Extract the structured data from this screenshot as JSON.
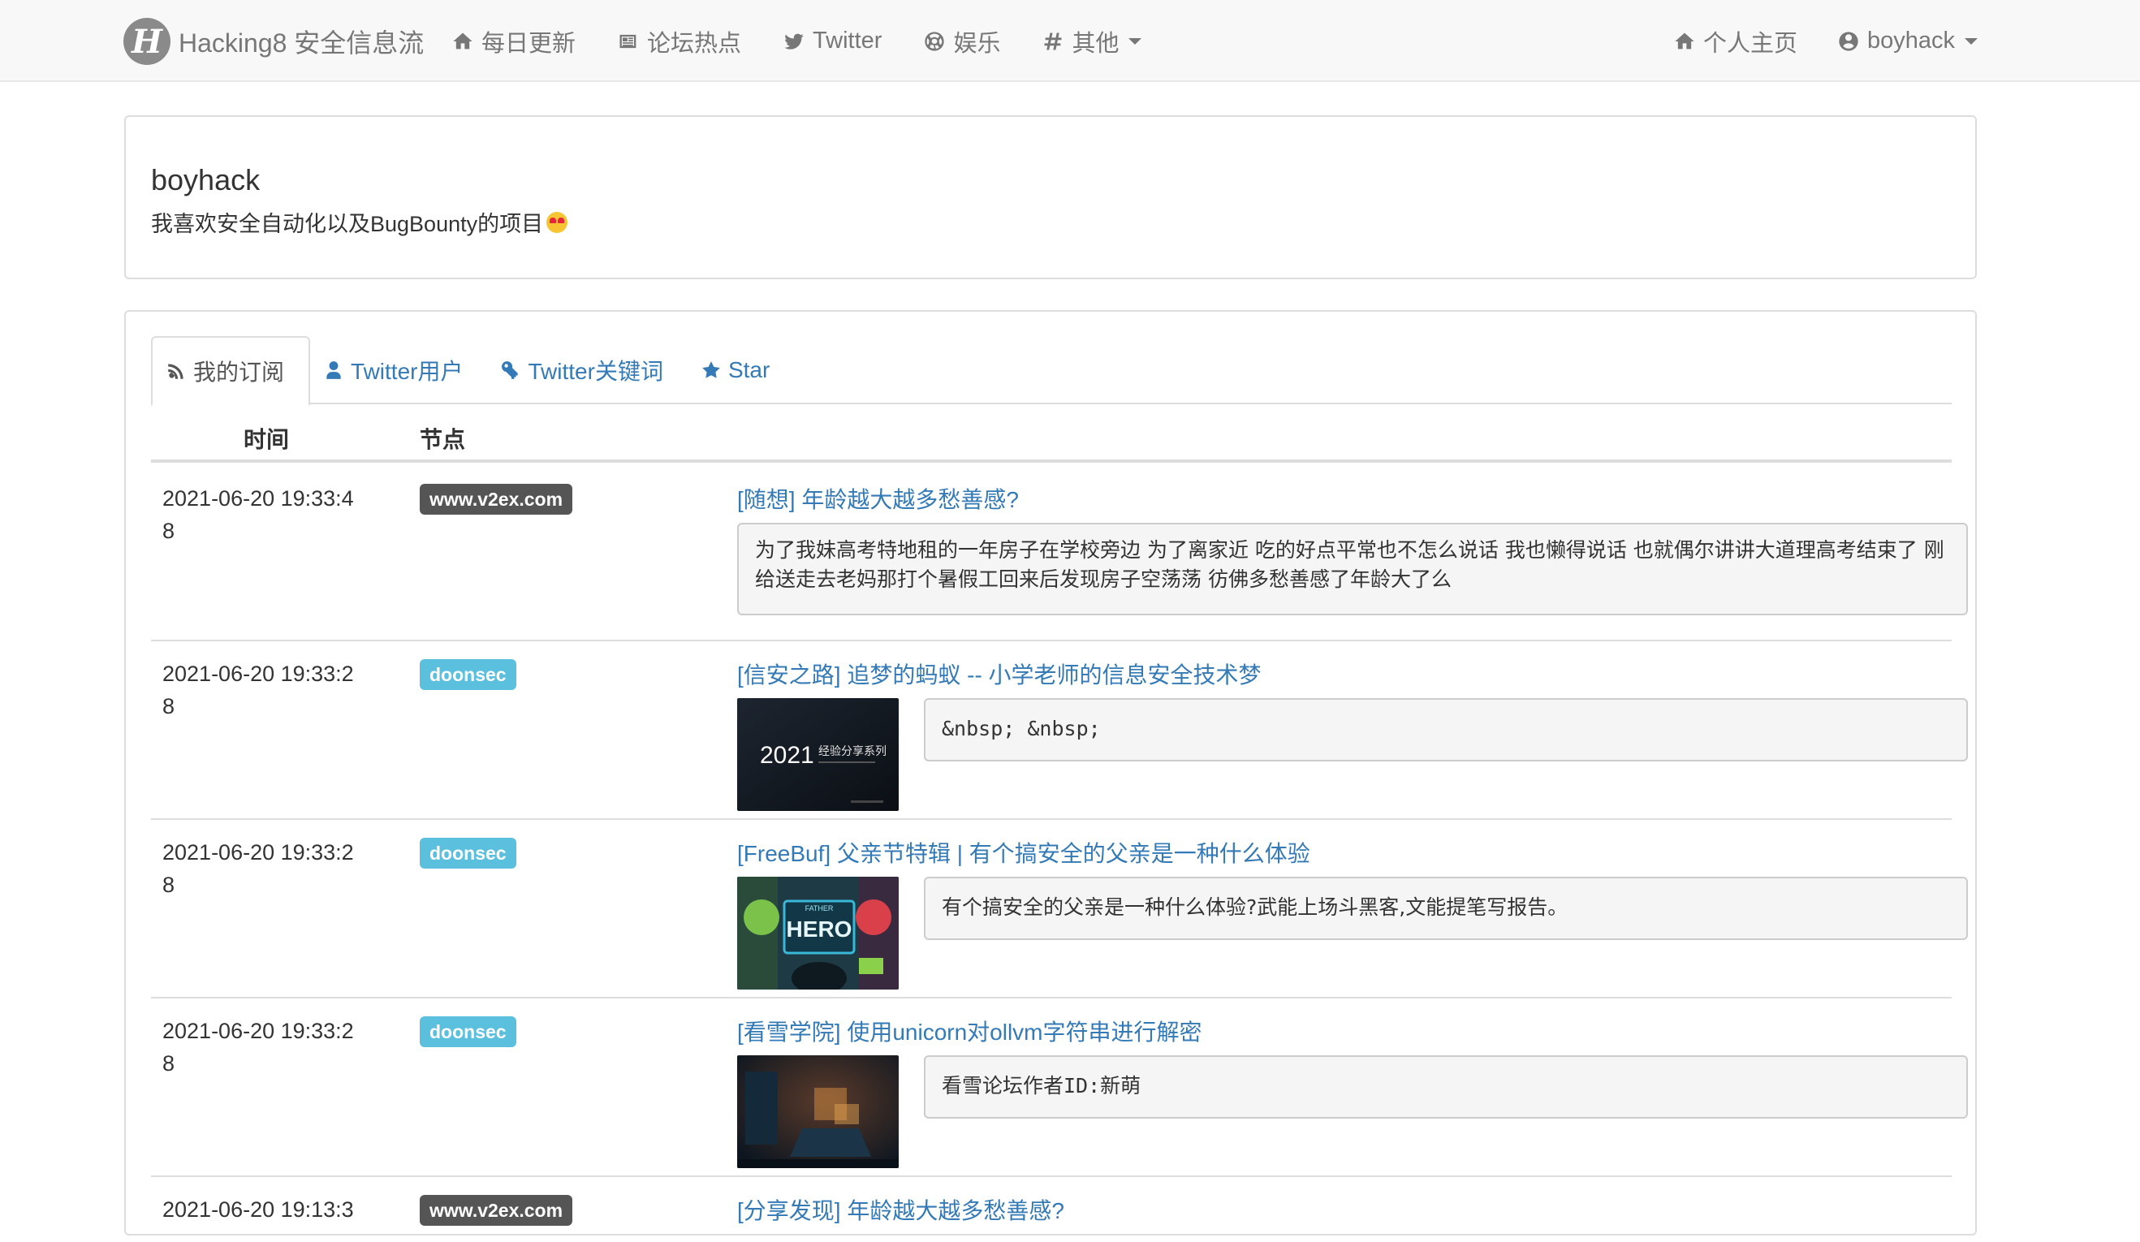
{
  "navbar": {
    "brand": "Hacking8 安全信息流",
    "brand_logo_letter": "H",
    "left_items": [
      {
        "label": "每日更新",
        "icon": "home-icon"
      },
      {
        "label": "论坛热点",
        "icon": "newspaper-icon"
      },
      {
        "label": "Twitter",
        "icon": "twitter-icon"
      },
      {
        "label": "娱乐",
        "icon": "soccer-ball-icon"
      },
      {
        "label": "其他",
        "icon": "hashtag-icon",
        "dropdown": true
      }
    ],
    "right_items": [
      {
        "label": "个人主页",
        "icon": "home-icon"
      },
      {
        "label": "boyhack",
        "icon": "user-circle-icon",
        "dropdown": true
      }
    ]
  },
  "profile": {
    "name": "boyhack",
    "bio": "我喜欢安全自动化以及BugBounty的项目"
  },
  "tabs": [
    {
      "label": "我的订阅",
      "icon": "rss-icon",
      "active": true
    },
    {
      "label": "Twitter用户",
      "icon": "user-icon",
      "active": false
    },
    {
      "label": "Twitter关键词",
      "icon": "key-icon",
      "active": false
    },
    {
      "label": "Star",
      "icon": "star-icon",
      "active": false
    }
  ],
  "table": {
    "headers": {
      "time": "时间",
      "node": "节点"
    },
    "rows": [
      {
        "time": "2021-06-20 19:33:48",
        "node": "www.v2ex.com",
        "node_color": "#555555",
        "title": "[随想] 年龄越大越多愁善感?",
        "desc": "为了我妹高考特地租的一年房子在学校旁边 为了离家近 吃的好点平常也不怎么说话 我也懒得说话 也就偶尔讲讲大道理高考结束了 刚给送走去老妈那打个暑假工回来后发现房子空荡荡 彷佛多愁善感了年龄大了么",
        "thumb": null
      },
      {
        "time": "2021-06-20 19:33:28",
        "node": "doonsec",
        "node_color": "#5bc0de",
        "title": "[信安之路] 追梦的蚂蚁 -- 小学老师的信息安全技术梦",
        "desc": "&nbsp; &nbsp;",
        "thumb": {
          "kind": "dark-banner",
          "text_big": "2021",
          "text_small": "经验分享系列"
        }
      },
      {
        "time": "2021-06-20 19:33:28",
        "node": "doonsec",
        "node_color": "#5bc0de",
        "title": "[FreeBuf] 父亲节特辑 | 有个搞安全的父亲是一种什么体验",
        "desc": "有个搞安全的父亲是一种什么体验?武能上场斗黑客,文能提笔写报告。",
        "thumb": {
          "kind": "hero-poster",
          "text_big": "HERO",
          "text_small": "FATHER"
        }
      },
      {
        "time": "2021-06-20 19:33:28",
        "node": "doonsec",
        "node_color": "#5bc0de",
        "title": "[看雪学院] 使用unicorn对ollvm字符串进行解密",
        "desc": "看雪论坛作者ID:新萌",
        "thumb": {
          "kind": "dark-room"
        }
      },
      {
        "time": "2021-06-20 19:13:3",
        "node": "www.v2ex.com",
        "node_color": "#555555",
        "title": "[分享发现] 年龄越大越多愁善感?",
        "desc": "",
        "thumb": null
      }
    ]
  },
  "colors": {
    "link": "#337ab7",
    "label_default": "#555555",
    "label_info": "#5bc0de",
    "navbar_bg": "#f8f8f8",
    "border": "#dddddd"
  }
}
